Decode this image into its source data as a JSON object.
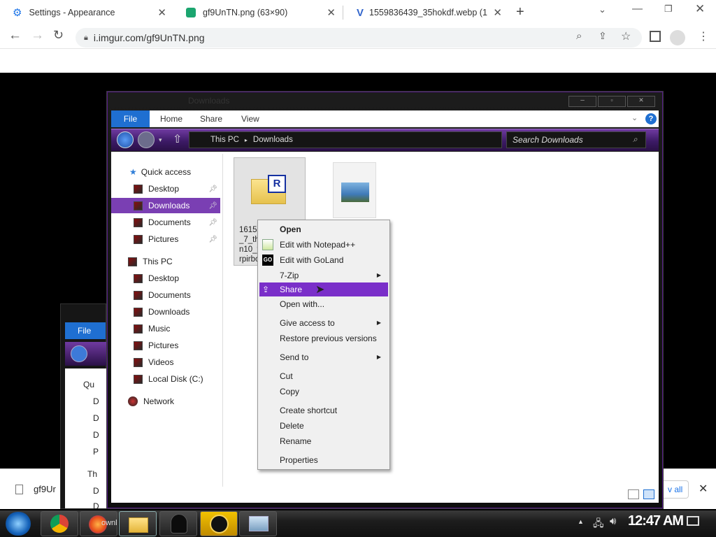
{
  "browser": {
    "tabs": [
      {
        "title": "Settings - Appearance"
      },
      {
        "title": "gf9UnTN.png (63×90)"
      },
      {
        "title": "1559836439_35hokdf.webp (1"
      }
    ],
    "url": "i.imgur.com/gf9UnTN.png",
    "download_item": "gf9Ur",
    "show_all": "v all"
  },
  "explorer": {
    "title": "Downloads",
    "ribbon_tabs": [
      "File",
      "Home",
      "Share",
      "View"
    ],
    "breadcrumb": [
      "This PC",
      "Downloads"
    ],
    "search_placeholder": "Search Downloads",
    "nav": {
      "quick_access": "Quick access",
      "quick_items": [
        "Desktop",
        "Downloads",
        "Documents",
        "Pictures"
      ],
      "this_pc": "This PC",
      "pc_items": [
        "Desktop",
        "Documents",
        "Downloads",
        "Music",
        "Pictures",
        "Videos",
        "Local Disk (C:)"
      ],
      "network": "Network"
    },
    "file_label_lines": [
      "1615",
      "_7_th",
      "n10_t",
      "rpirbc"
    ]
  },
  "back_window": {
    "file_tab": "File",
    "partial_labels": [
      "Qu",
      "D",
      "D",
      "D",
      "P",
      "Th",
      "D",
      "D"
    ]
  },
  "context_menu": {
    "items": [
      {
        "label": "Open",
        "bold": true
      },
      {
        "label": "Edit with Notepad++",
        "icon": "notepad-icon"
      },
      {
        "label": "Edit with GoLand",
        "icon": "goland-icon"
      },
      {
        "label": "7-Zip",
        "submenu": true
      },
      {
        "label": "Share",
        "highlighted": true,
        "icon": "share-icon"
      },
      {
        "label": "Open with..."
      },
      {
        "label": "Give access to",
        "submenu": true
      },
      {
        "label": "Restore previous versions"
      },
      {
        "label": "Send to",
        "submenu": true
      },
      {
        "label": "Cut"
      },
      {
        "label": "Copy"
      },
      {
        "label": "Create shortcut"
      },
      {
        "label": "Delete"
      },
      {
        "label": "Rename"
      },
      {
        "label": "Properties"
      }
    ]
  },
  "taskbar": {
    "clock": "12:47 AM",
    "app_partial": "ownlo"
  },
  "colors": {
    "accent_purple": "#7a2fc9",
    "nav_selected": "#7a3fb3",
    "chrome_blue": "#1a73e8"
  }
}
